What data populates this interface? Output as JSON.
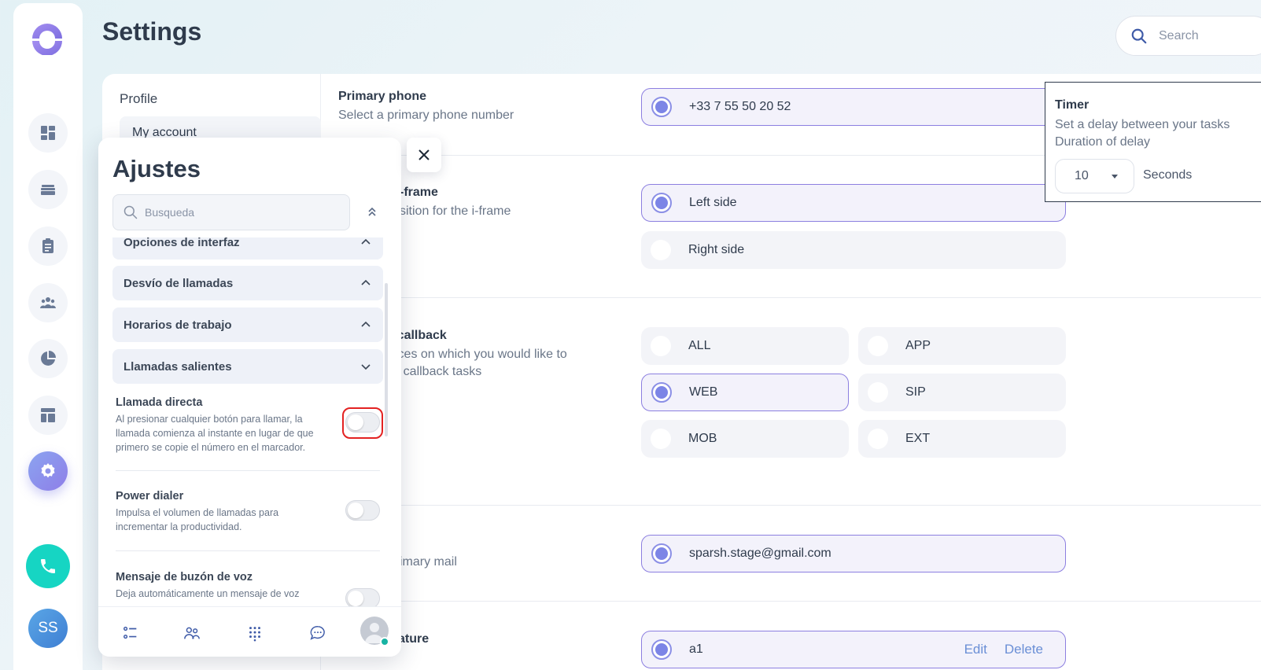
{
  "page": {
    "title": "Settings",
    "search_placeholder": "Search"
  },
  "rail": {
    "items": [
      "dashboard-icon",
      "inbox-icon",
      "clipboard-icon",
      "team-icon",
      "reports-icon",
      "layout-icon",
      "settings-icon"
    ],
    "avatar_initials": "SS"
  },
  "settings_nav": {
    "section": "Profile",
    "active_item": "My account"
  },
  "rows": {
    "primary_phone": {
      "title": "Primary phone",
      "subtitle": "Select a primary phone number",
      "value": "+33 7 55 50 20 52"
    },
    "iframe": {
      "title_visible": "-frame",
      "subtitle_visible": "sition for the i-frame",
      "options": [
        "Left side",
        "Right side"
      ],
      "selected": "Left side"
    },
    "callback": {
      "title_visible": "r callback",
      "subtitle_visible_1": "vices on which you would like to",
      "subtitle_visible_2": "ur callback tasks",
      "options": [
        "ALL",
        "APP",
        "WEB",
        "SIP",
        "MOB",
        "EXT"
      ],
      "selected": "WEB"
    },
    "mail": {
      "subtitle_visible": "imary mail",
      "value": "sparsh.stage@gmail.com"
    },
    "signature": {
      "title_visible": "ature",
      "value": "a1",
      "edit_label": "Edit",
      "delete_label": "Delete"
    }
  },
  "timer": {
    "title": "Timer",
    "subtitle": "Set a delay between your tasks",
    "duration_label": "Duration of delay",
    "value": "10",
    "unit": "Seconds"
  },
  "panel": {
    "title": "Ajustes",
    "search_placeholder": "Busqueda",
    "accordions": [
      {
        "label": "Opciones de interfaz",
        "expanded": true
      },
      {
        "label": "Desvío de llamadas",
        "expanded": true
      },
      {
        "label": "Horarios de trabajo",
        "expanded": true
      },
      {
        "label": "Llamadas salientes",
        "expanded": false
      }
    ],
    "settings": [
      {
        "title": "Llamada directa",
        "desc": "Al presionar cualquier botón para llamar, la llamada comienza al instante en lugar de que primero se copie el número en el marcador.",
        "enabled": false
      },
      {
        "title": "Power dialer",
        "desc": "Impulsa el volumen de llamadas para incrementar la productividad.",
        "enabled": false
      },
      {
        "title": "Mensaje de buzón de voz",
        "desc": "Deja automáticamente un mensaje de voz",
        "enabled": false
      }
    ],
    "bottom_nav": [
      "list-icon",
      "contacts-icon",
      "dialpad-icon",
      "chat-icon",
      "profile-avatar"
    ]
  },
  "colors": {
    "accent": "#8c7fe0",
    "radio_fill": "#7c85e6",
    "call_button": "#16d5c3",
    "highlight_ring": "#e32222"
  }
}
